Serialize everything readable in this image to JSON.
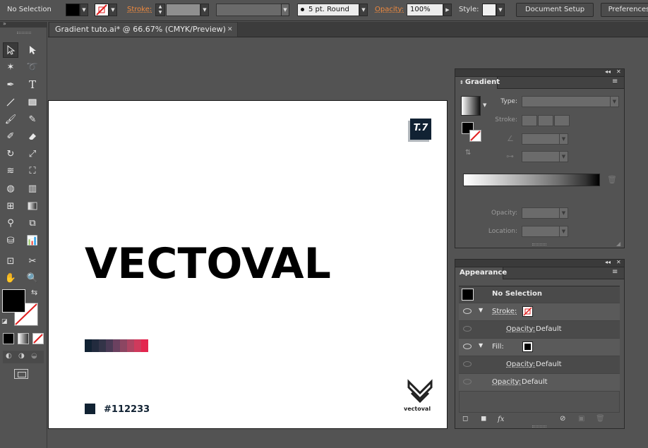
{
  "control_bar": {
    "selection_label": "No Selection",
    "stroke_label": "Stroke:",
    "brush_label": "5 pt. Round",
    "opacity_label": "Opacity:",
    "opacity_value": "100%",
    "style_label": "Style:",
    "document_setup_label": "Document Setup",
    "preferences_label": "Preferences"
  },
  "document": {
    "tab_title": "Gradient tuto.ai* @ 66.67% (CMYK/Preview)",
    "close_glyph": "✕"
  },
  "artboard": {
    "wordmark": "VECTOVAL",
    "badge": "T.7",
    "hex_label": "#112233",
    "logo_text": "vectoval",
    "gradient_steps": [
      "#112233",
      "#222b3e",
      "#333448",
      "#4a3a55",
      "#6b4160",
      "#8c4662",
      "#ad4462",
      "#cf3a5c",
      "#e3264f"
    ],
    "primary_color": "#112233"
  },
  "gradient_panel": {
    "title": "Gradient",
    "type_label": "Type:",
    "stroke_label": "Stroke:",
    "opacity_label": "Opacity:",
    "location_label": "Location:",
    "collapse_glyph": "◂◂",
    "close_glyph": "✕",
    "menu_glyph": "≡"
  },
  "appearance_panel": {
    "title": "Appearance",
    "header": "No Selection",
    "rows": [
      {
        "kind": "stroke",
        "label": "Stroke:",
        "value": ""
      },
      {
        "kind": "opacity",
        "label": "Opacity:",
        "value": "Default"
      },
      {
        "kind": "fill",
        "label": "Fill:",
        "value": ""
      },
      {
        "kind": "opacity",
        "label": "Opacity:",
        "value": "Default"
      },
      {
        "kind": "opacity",
        "label": "Opacity:",
        "value": "Default"
      }
    ],
    "fx_label": "fx"
  },
  "colors": {
    "ui_bg": "#535353",
    "accent_orange": "#f08a3e",
    "artboard_bg": "#ffffff"
  }
}
